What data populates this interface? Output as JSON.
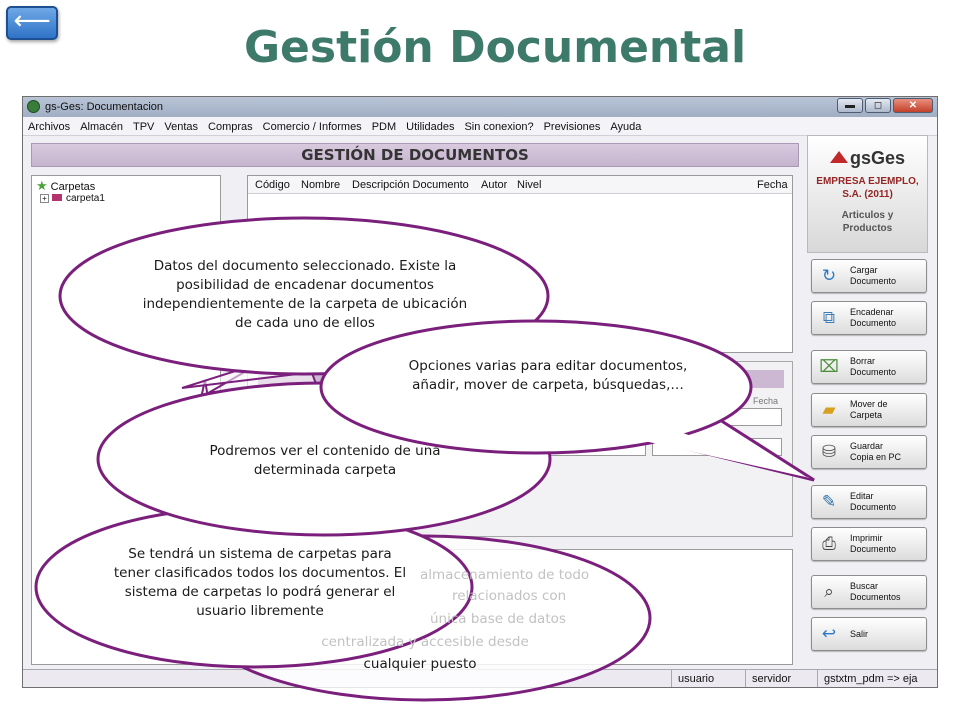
{
  "slide": {
    "back_button": "⟵",
    "title": "Gestión Documental"
  },
  "window": {
    "title": "gs-Ges: Documentacion",
    "controls": [
      "▬",
      "◻",
      "✕"
    ]
  },
  "menu": [
    "Archivos",
    "Almacén",
    "TPV",
    "Ventas",
    "Compras",
    "Comercio / Informes",
    "PDM",
    "Utilidades",
    "Sin conexion?",
    "Previsiones",
    "Ayuda"
  ],
  "header": {
    "title": "GESTIÓN DE DOCUMENTOS"
  },
  "logo": {
    "brand": "gsGes",
    "company_line1": "EMPRESA EJEMPLO,",
    "company_line2": "S.A. (2011)",
    "module_line1": "Articulos y",
    "module_line2": "Productos"
  },
  "tree": {
    "root": "Carpetas",
    "child": "carpeta1",
    "expander": "+"
  },
  "table": {
    "columns": [
      "Código",
      "Nombre",
      "Descripción Documento",
      "Autor",
      "Nivel",
      "Fecha"
    ]
  },
  "detail_fields": {
    "fecha": "Fecha",
    "autor": "Autor"
  },
  "actions": [
    {
      "line1": "Cargar",
      "line2": "Documento",
      "icon": "load-document-icon"
    },
    {
      "line1": "Encadenar",
      "line2": "Documento",
      "icon": "chain-document-icon"
    },
    {
      "line1": "Borrar",
      "line2": "Documento",
      "icon": "delete-document-icon"
    },
    {
      "line1": "Mover de",
      "line2": "Carpeta",
      "icon": "move-folder-icon"
    },
    {
      "line1": "Guardar",
      "line2": "Copia en PC",
      "icon": "save-copy-icon"
    },
    {
      "line1": "Editar",
      "line2": "Documento",
      "icon": "edit-document-icon"
    },
    {
      "line1": "Imprimir",
      "line2": "Documento",
      "icon": "print-icon"
    },
    {
      "line1": "Buscar",
      "line2": "Documentos",
      "icon": "search-documents-icon"
    },
    {
      "line1": "Salir",
      "line2": "",
      "icon": "exit-icon"
    }
  ],
  "status": {
    "user": "usuario",
    "server": "servidor",
    "db": "gstxtm_pdm => eja"
  },
  "callouts": {
    "document_data": "Datos del documento seleccionado. Existe la posibilidad de encadenar documentos independientemente de la carpeta de ubicación de cada uno de ellos",
    "options": "Opciones varias para editar documentos, añadir, mover de carpeta, búsquedas,…",
    "folder_contents": "Podremos ver el contenido de una determinada carpeta",
    "folders": "Se tendrá un sistema de carpetas para tener clasificados todos los documentos. El sistema de carpetas lo podrá generar el usuario libremente",
    "storage_visible": "almacenamiento de todo",
    "storage_line2": "relacionados con",
    "storage_line3": "única base de datos",
    "storage_line4": "centralizada y accesible desde",
    "storage_line5": "cualquier puesto"
  }
}
